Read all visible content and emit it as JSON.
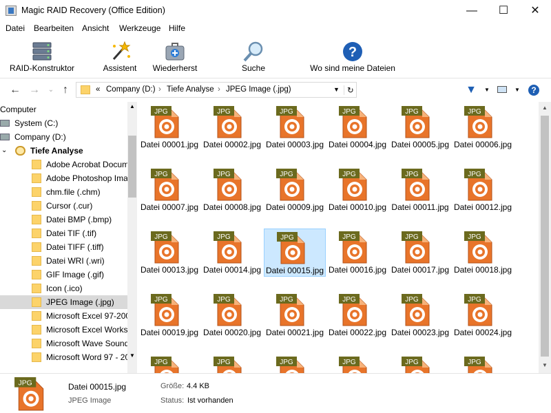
{
  "window": {
    "title": "Magic RAID Recovery (Office Edition)",
    "min": "—",
    "max": "☐",
    "close": "✕"
  },
  "menu": [
    "Datei",
    "Bearbeiten",
    "Ansicht",
    "Werkzeuge",
    "Hilfe"
  ],
  "toolbar": {
    "raid": "RAID-Konstruktor",
    "assistant": "Assistent",
    "restore": "Wiederherst",
    "search": "Suche",
    "where": "Wo sind meine Dateien"
  },
  "address": {
    "prefix": "«",
    "drive": "Company (D:)",
    "folder1": "Tiefe Analyse",
    "folder2": "JPEG Image (.jpg)",
    "sep": "›"
  },
  "tree": {
    "root": "Computer",
    "drives": [
      "System (C:)",
      "Company (D:)"
    ],
    "analysis": "Tiefe Analyse",
    "folders": [
      "Adobe Acrobat Docum",
      "Adobe Photoshop Ima",
      "chm.file (.chm)",
      "Cursor (.cur)",
      "Datei BMP (.bmp)",
      "Datei TIF (.tif)",
      "Datei TIFF (.tiff)",
      "Datei WRI (.wri)",
      "GIF Image (.gif)",
      "Icon (.ico)",
      "JPEG Image (.jpg)",
      "Microsoft Excel 97-200",
      "Microsoft Excel Works",
      "Microsoft Wave Sound",
      "Microsoft Word 97 - 20"
    ],
    "selected_index": 10
  },
  "files": {
    "badge": "JPG",
    "names": [
      "Datei 00001.jpg",
      "Datei 00002.jpg",
      "Datei 00003.jpg",
      "Datei 00004.jpg",
      "Datei 00005.jpg",
      "Datei 00006.jpg",
      "Datei 00007.jpg",
      "Datei 00008.jpg",
      "Datei 00009.jpg",
      "Datei 00010.jpg",
      "Datei 00011.jpg",
      "Datei 00012.jpg",
      "Datei 00013.jpg",
      "Datei 00014.jpg",
      "Datei 00015.jpg",
      "Datei 00016.jpg",
      "Datei 00017.jpg",
      "Datei 00018.jpg",
      "Datei 00019.jpg",
      "Datei 00020.jpg",
      "Datei 00021.jpg",
      "Datei 00022.jpg",
      "Datei 00023.jpg",
      "Datei 00024.jpg",
      "",
      "",
      "",
      "",
      "",
      ""
    ],
    "selected_index": 14
  },
  "status": {
    "badge": "JPG",
    "name": "Datei 00015.jpg",
    "type": "JPEG Image",
    "size_label": "Größe:",
    "size": "4.4 KB",
    "status_label": "Status:",
    "status": "Ist vorhanden"
  },
  "colors": {
    "accent": "#1e5fb4",
    "selection": "#cce8ff",
    "icon_orange": "#e8742a",
    "badge_green": "#6b6a1e"
  }
}
